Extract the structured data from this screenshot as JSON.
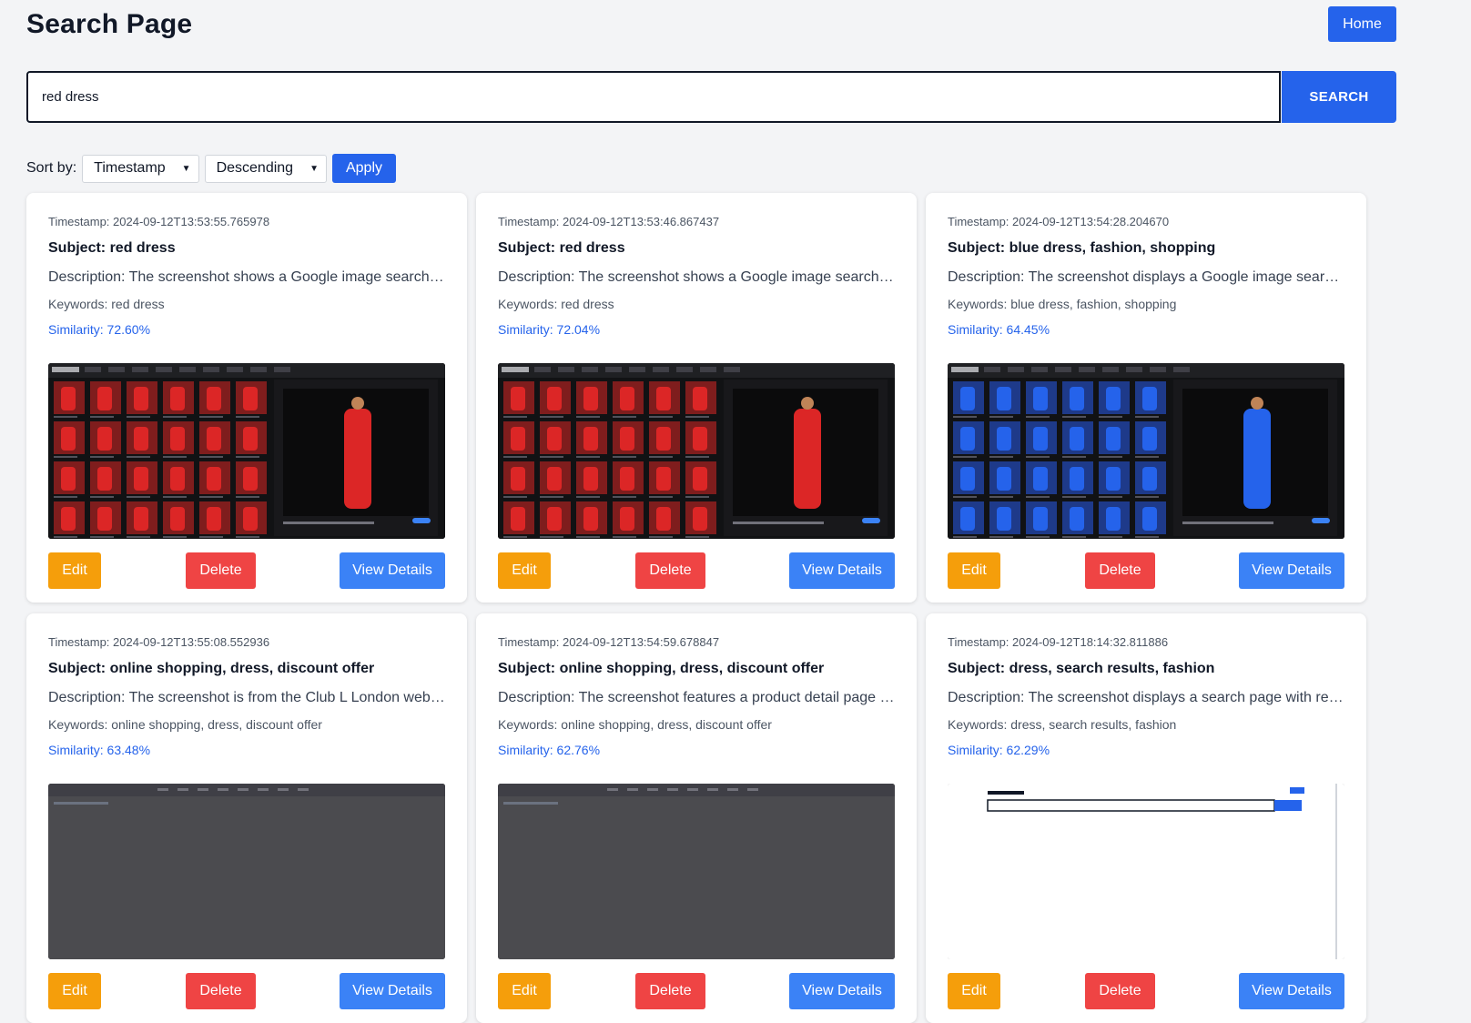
{
  "page": {
    "title": "Search Page",
    "home_label": "Home"
  },
  "search": {
    "value": "red dress",
    "button_label": "SEARCH"
  },
  "sort": {
    "label": "Sort by:",
    "field": "Timestamp",
    "order": "Descending",
    "apply_label": "Apply"
  },
  "actions": {
    "edit": "Edit",
    "delete": "Delete",
    "view": "View Details"
  },
  "colors": {
    "primary": "#2563eb",
    "edit": "#f59e0b",
    "delete": "#ef4444",
    "view": "#3b82f6"
  },
  "results": [
    {
      "timestamp": "Timestamp: 2024-09-12T13:53:55.765978",
      "subject": "Subject: red dress",
      "description": "Description: The screenshot shows a Google image search for red dresses with various results",
      "keywords": "Keywords: red dress",
      "similarity": "Similarity: 72.60%",
      "thumb_theme": "red"
    },
    {
      "timestamp": "Timestamp: 2024-09-12T13:53:46.867437",
      "subject": "Subject: red dress",
      "description": "Description: The screenshot shows a Google image search results page",
      "keywords": "Keywords: red dress",
      "similarity": "Similarity: 72.04%",
      "thumb_theme": "red"
    },
    {
      "timestamp": "Timestamp: 2024-09-12T13:54:28.204670",
      "subject": "Subject: blue dress, fashion, shopping",
      "description": "Description: The screenshot displays a Google image search page",
      "keywords": "Keywords: blue dress, fashion, shopping",
      "similarity": "Similarity: 64.45%",
      "thumb_theme": "blue"
    },
    {
      "timestamp": "Timestamp: 2024-09-12T13:55:08.552936",
      "subject": "Subject: online shopping, dress, discount offer",
      "description": "Description: The screenshot is from the Club L London website",
      "keywords": "Keywords: online shopping, dress, discount offer",
      "similarity": "Similarity: 63.48%",
      "thumb_theme": "gray"
    },
    {
      "timestamp": "Timestamp: 2024-09-12T13:54:59.678847",
      "subject": "Subject: online shopping, dress, discount offer",
      "description": "Description: The screenshot features a product detail page from",
      "keywords": "Keywords: online shopping, dress, discount offer",
      "similarity": "Similarity: 62.76%",
      "thumb_theme": "gray"
    },
    {
      "timestamp": "Timestamp: 2024-09-12T18:14:32.811886",
      "subject": "Subject: dress, search results, fashion",
      "description": "Description: The screenshot displays a search page with results",
      "keywords": "Keywords: dress, search results, fashion",
      "similarity": "Similarity: 62.29%",
      "thumb_theme": "light"
    }
  ]
}
